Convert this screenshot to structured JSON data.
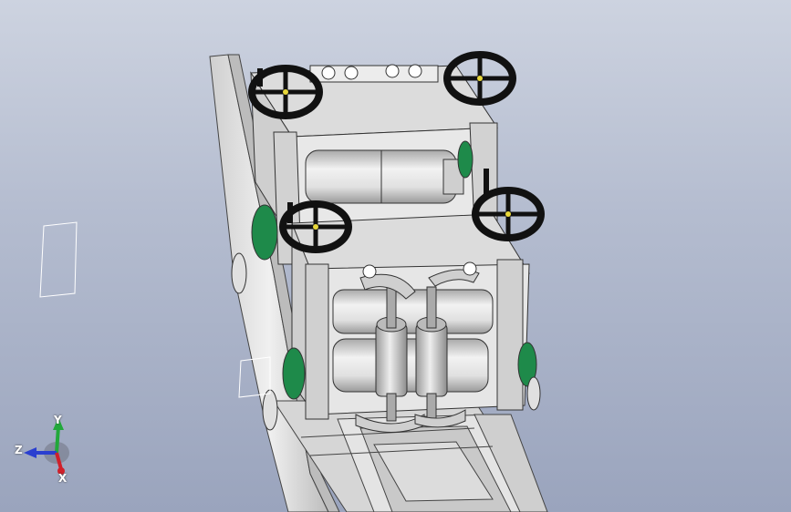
{
  "viewport": {
    "background_top": "#cdd3e0",
    "background_bottom": "#9aa4bd",
    "model_colors": {
      "frame": "#d9d9d9",
      "roller": "#e6e6e6",
      "bearing_green": "#1e8a4a",
      "handwheel": "#1a1a1a"
    }
  },
  "triad": {
    "x_label": "X",
    "y_label": "Y",
    "z_label": "Z",
    "x_color": "#d0202a",
    "y_color": "#22a83a",
    "z_color": "#2a3fd0"
  },
  "icons": [
    "handwheel-icon",
    "roller-icon",
    "bearing-icon",
    "triad-icon"
  ]
}
